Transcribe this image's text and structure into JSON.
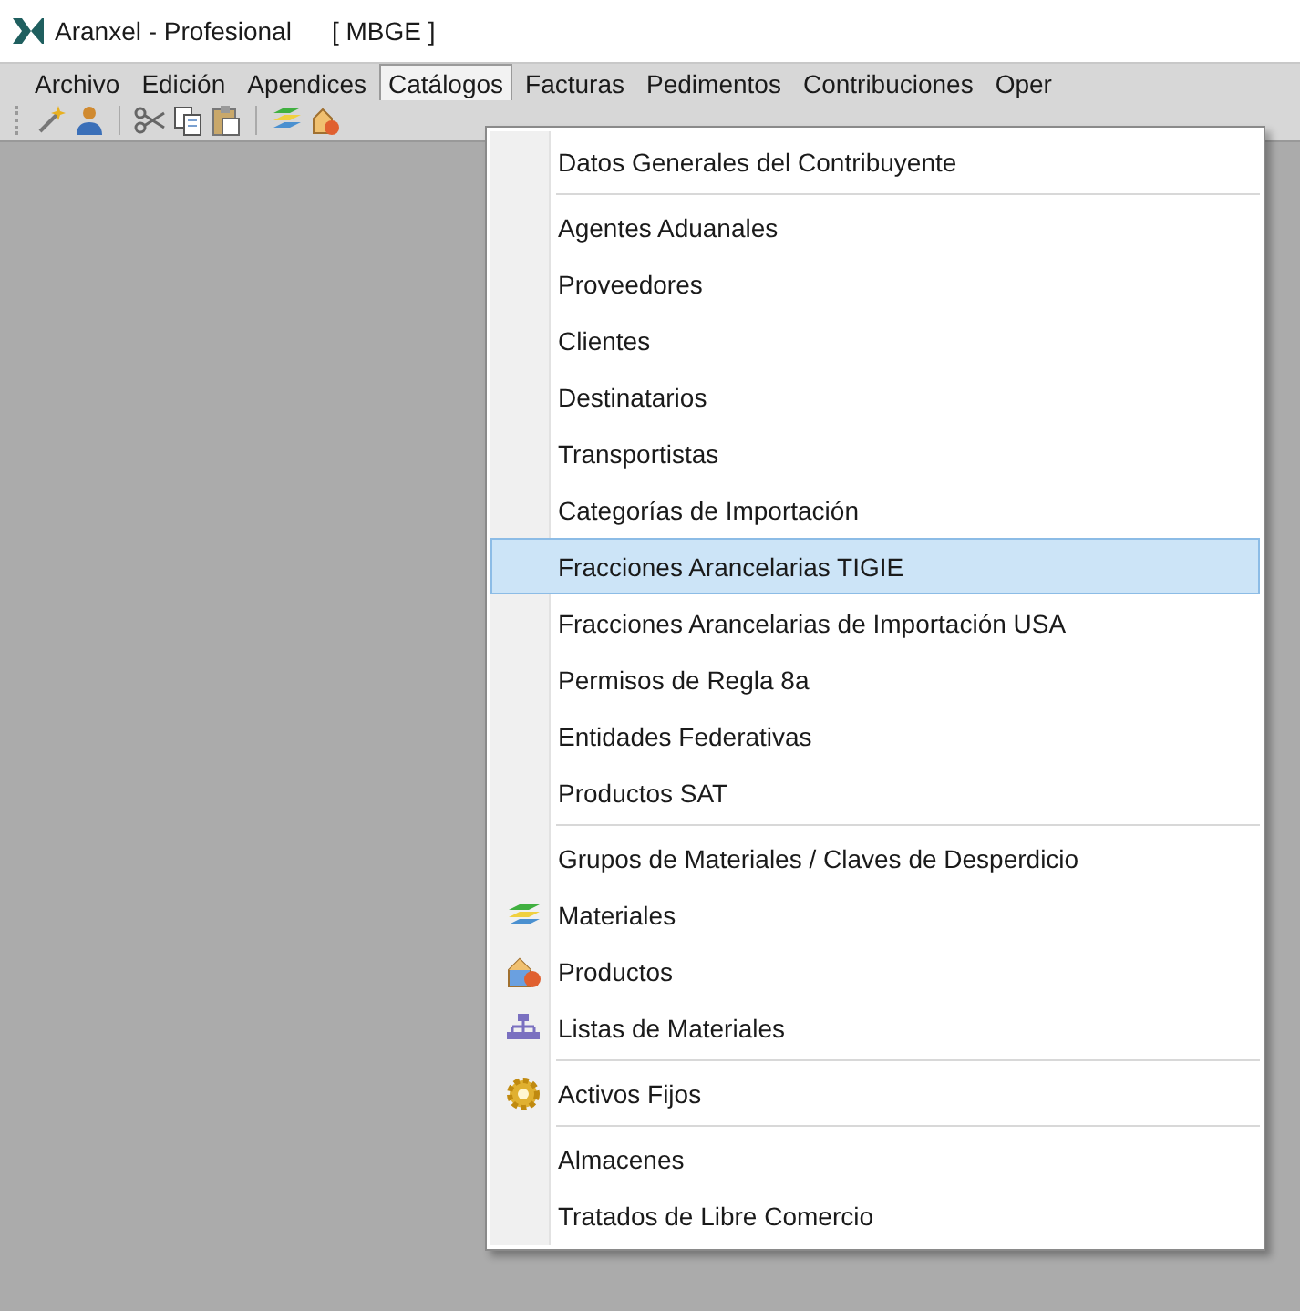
{
  "window": {
    "title": "Aranxel - Profesional",
    "badge": "[ MBGE ]"
  },
  "menubar": [
    {
      "label": "Archivo",
      "selected": false
    },
    {
      "label": "Edición",
      "selected": false
    },
    {
      "label": "Apendices",
      "selected": false
    },
    {
      "label": "Catálogos",
      "selected": true
    },
    {
      "label": "Facturas",
      "selected": false
    },
    {
      "label": "Pedimentos",
      "selected": false
    },
    {
      "label": "Contribuciones",
      "selected": false
    },
    {
      "label": "Oper",
      "selected": false
    }
  ],
  "dropdown": {
    "groups": [
      [
        {
          "label": "Datos Generales del Contribuyente",
          "kind": "text",
          "selected": false
        }
      ],
      [
        {
          "label": "Agentes Aduanales",
          "kind": "text",
          "selected": false
        },
        {
          "label": "Proveedores",
          "kind": "text",
          "selected": false
        },
        {
          "label": "Clientes",
          "kind": "text",
          "selected": false
        },
        {
          "label": "Destinatarios",
          "kind": "text",
          "selected": false
        },
        {
          "label": "Transportistas",
          "kind": "text",
          "selected": false
        },
        {
          "label": "Categorías de Importación",
          "kind": "text",
          "selected": false
        },
        {
          "label": "Fracciones Arancelarias TIGIE",
          "kind": "text",
          "selected": true
        },
        {
          "label": "Fracciones Arancelarias de Importación USA",
          "kind": "text",
          "selected": false
        },
        {
          "label": "Permisos de Regla 8a",
          "kind": "text",
          "selected": false
        },
        {
          "label": "Entidades Federativas",
          "kind": "text",
          "selected": false
        },
        {
          "label": "Productos SAT",
          "kind": "text",
          "selected": false
        }
      ],
      [
        {
          "label": "Grupos de Materiales / Claves de Desperdicio",
          "kind": "text",
          "selected": false
        },
        {
          "label": "Materiales",
          "kind": "layers",
          "selected": false
        },
        {
          "label": "Productos",
          "kind": "boxes",
          "selected": false
        },
        {
          "label": "Listas de Materiales",
          "kind": "tree",
          "selected": false
        }
      ],
      [
        {
          "label": "Activos Fijos",
          "kind": "gear",
          "selected": false
        }
      ],
      [
        {
          "label": "Almacenes",
          "kind": "text",
          "selected": false
        },
        {
          "label": "Tratados de Libre Comercio",
          "kind": "text",
          "selected": false
        }
      ]
    ]
  }
}
